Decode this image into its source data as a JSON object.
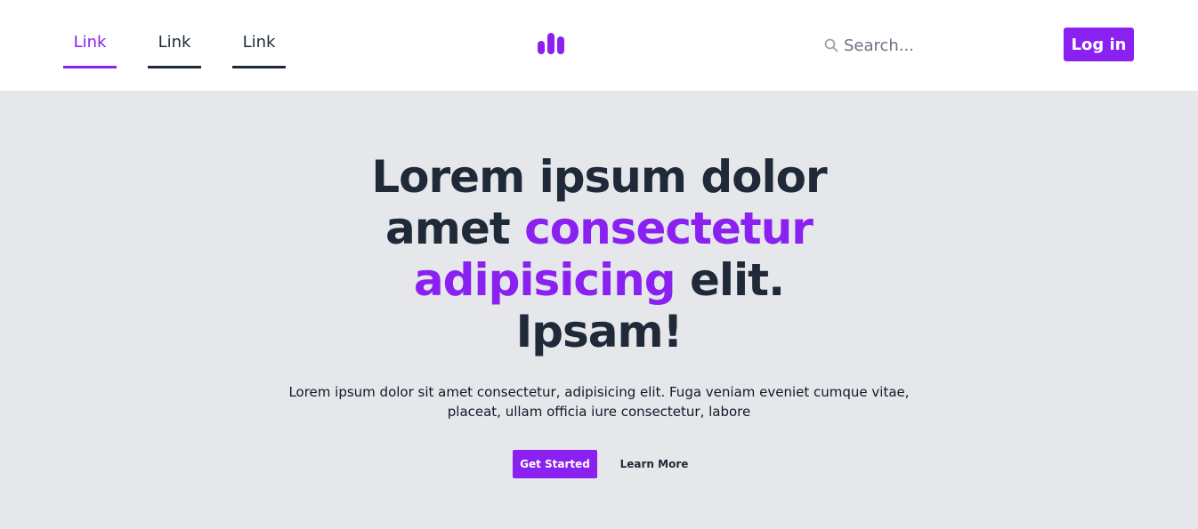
{
  "nav": {
    "links": [
      {
        "label": "Link",
        "active": true
      },
      {
        "label": "Link",
        "active": false
      },
      {
        "label": "Link",
        "active": false
      }
    ],
    "logo_icon": "bar-chart-icon"
  },
  "search": {
    "placeholder": "Search...",
    "value": "",
    "icon": "search-icon"
  },
  "header": {
    "login_label": "Log in"
  },
  "hero": {
    "headline_part1": "Lorem ipsum dolor amet ",
    "headline_accent": "consectetur adipisicing",
    "headline_part2": " elit. Ipsam!",
    "description": "Lorem ipsum dolor sit amet consectetur, adipisicing elit. Fuga veniam eveniet cumque vitae, placeat, ullam officia iure consectetur, labore",
    "primary_label": "Get Started",
    "secondary_label": "Learn More"
  },
  "colors": {
    "accent": "#8a21f0",
    "text": "#1f2937",
    "hero_bg": "#e5e7eb",
    "header_bg": "#ffffff"
  }
}
